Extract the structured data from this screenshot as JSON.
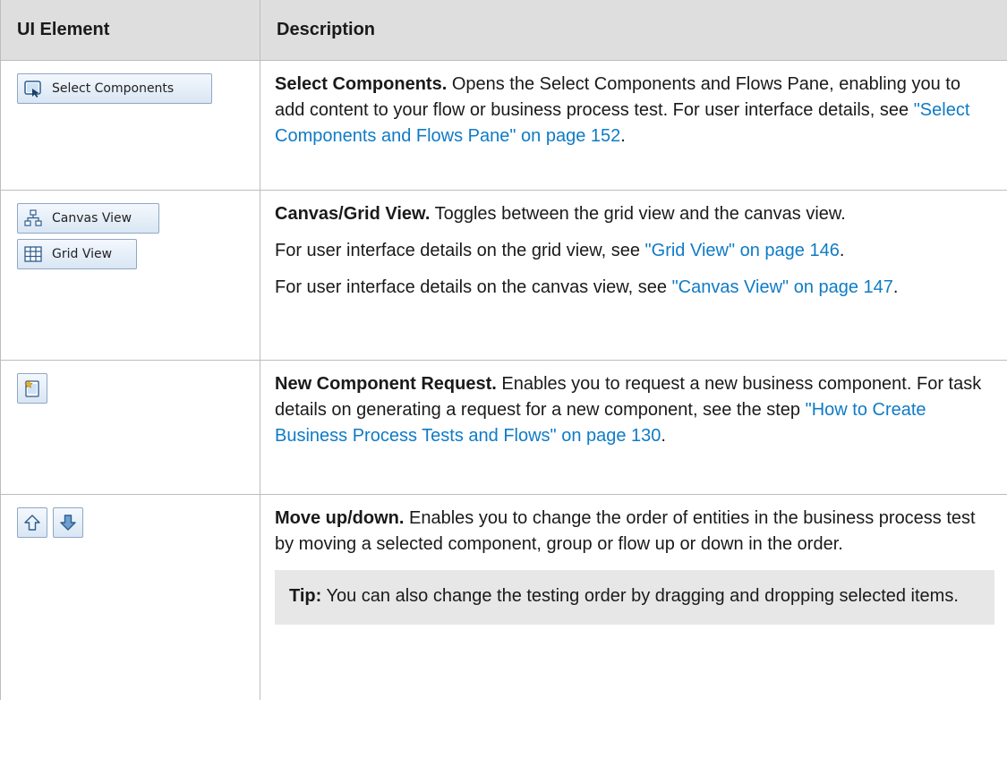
{
  "header": {
    "col1": "UI Element",
    "col2": "Description"
  },
  "rows": [
    {
      "buttons": [
        {
          "label": "Select Components",
          "icon": "select-components-icon"
        }
      ],
      "title": "Select Components.",
      "text": " Opens the Select Components and Flows Pane, enabling you to add content to your flow or business process test. For user interface details, see ",
      "link": "\"Select Components and Flows Pane\" on page 152",
      "end": "."
    },
    {
      "buttons": [
        {
          "label": "Canvas View",
          "icon": "canvas-view-icon"
        },
        {
          "label": "Grid View",
          "icon": "grid-view-icon"
        }
      ],
      "title": "Canvas/Grid View.",
      "text": " Toggles between the grid view and the canvas view.",
      "p2_text": "For user interface details on the grid view, see ",
      "p2_link": "\"Grid View\" on page 146",
      "p3_text": "For user interface details on the canvas view, see ",
      "p3_link": "\"Canvas View\" on page 147",
      "end": "."
    },
    {
      "buttons": [
        {
          "label": "",
          "icon": "new-component-request-icon"
        }
      ],
      "title": "New Component Request.",
      "text": " Enables you to request a new business component. For task details on generating a request for a new component, see the step ",
      "link": "\"How to Create Business Process Tests and Flows\" on page 130",
      "end": "."
    },
    {
      "buttons": [
        {
          "label": "",
          "icon": "move-up-icon"
        },
        {
          "label": "",
          "icon": "move-down-icon"
        }
      ],
      "title": "Move up/down.",
      "text": " Enables you to change the order of entities in the business process test by moving a selected component, group or flow up or down in the order.",
      "tip_title": "Tip:",
      "tip_text": " You can also change the testing order by dragging and dropping selected items."
    }
  ],
  "colors": {
    "link": "#0f7bc6",
    "header_bg": "#dedede",
    "tip_bg": "#e7e7e7"
  }
}
